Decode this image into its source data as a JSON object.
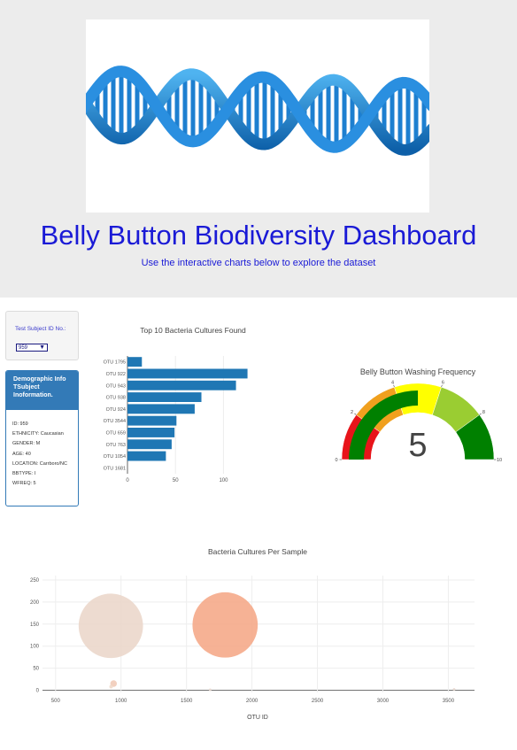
{
  "header": {
    "title": "Belly Button Biodiversity Dashboard",
    "subtitle": "Use the interactive charts below to explore the dataset"
  },
  "selector": {
    "label": "Test Subject ID No.:",
    "selected": "959"
  },
  "demographics": {
    "heading": "Demographic Info TSubject Inoformation.",
    "lines": [
      "ID: 959",
      "ETHNICITY: Caucasian",
      "GENDER: M",
      "AGE: 40",
      "LOCATION: Carrboro/NC",
      "BBTYPE: I",
      "WFREQ: 5"
    ]
  },
  "colors": {
    "accent": "#1a1ad6",
    "panel_blue": "#337ab7",
    "bar": "#1f77b4"
  },
  "chart_data": [
    {
      "type": "bar",
      "orientation": "horizontal",
      "title": "Top 10 Bacteria Cultures Found",
      "categories": [
        "OTU 1795",
        "OTU 922",
        "OTU 943",
        "OTU 938",
        "OTU 924",
        "OTU 3544",
        "OTU 659",
        "OTU 763",
        "OTU 1054",
        "OTU 1681"
      ],
      "values": [
        15,
        125,
        113,
        77,
        70,
        51,
        49,
        46,
        40,
        0
      ],
      "xticks": [
        0,
        50,
        100
      ],
      "xlim": [
        0,
        130
      ]
    },
    {
      "type": "gauge",
      "title": "Belly Button Washing Frequency",
      "value": 5,
      "range": [
        0,
        10
      ],
      "tick_labels": [
        "0",
        "2",
        "4",
        "6",
        "8",
        "10"
      ],
      "band_colors": [
        "#e8141a",
        "#f0a01e",
        "#ffff00",
        "#9acd32",
        "#008000"
      ]
    },
    {
      "type": "scatter",
      "subtype": "bubble",
      "title": "Bacteria Cultures Per Sample",
      "xlabel": "OTU ID",
      "xlim": [
        400,
        3700
      ],
      "ylim": [
        -5,
        260
      ],
      "xticks": [
        500,
        1000,
        1500,
        2000,
        2500,
        3000,
        3500
      ],
      "yticks": [
        0,
        50,
        100,
        150,
        200,
        250
      ],
      "points": [
        {
          "x": 922,
          "y": 146,
          "size": 146,
          "color": "#ead5c8"
        },
        {
          "x": 1795,
          "y": 148,
          "size": 148,
          "color": "#f4a582"
        },
        {
          "x": 943,
          "y": 15,
          "size": 15,
          "color": "#f0c8b4"
        },
        {
          "x": 924,
          "y": 8,
          "size": 8,
          "color": "#eed8c8"
        },
        {
          "x": 3544,
          "y": 2,
          "size": 2,
          "color": "#e8d8d0"
        },
        {
          "x": 1681,
          "y": 1,
          "size": 1,
          "color": "#e8d8d0"
        }
      ]
    }
  ]
}
